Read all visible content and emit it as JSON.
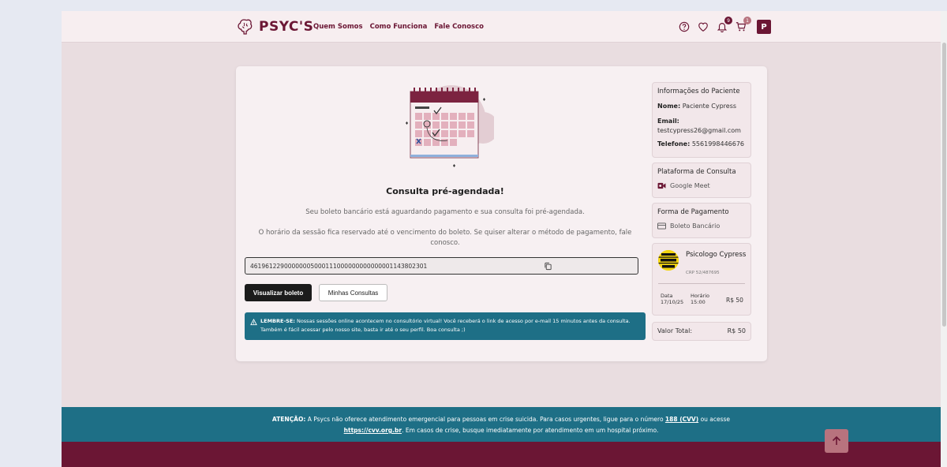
{
  "header": {
    "logo_text": "PSYC'S",
    "nav": [
      "Quem Somos",
      "Como Funciona",
      "Fale Conosco"
    ],
    "notification_count": "9",
    "cart_count": "1",
    "avatar_letter": "P",
    "colors": {
      "brand": "#6b1634",
      "header_bg": "#f7eef0"
    }
  },
  "main": {
    "title": "Consulta pré-agendada!",
    "message1": "Seu boleto bancário está aguardando pagamento e sua consulta foi pré-agendada.",
    "message2": "O horário da sessão fica reservado até o vencimento do boleto. Se quiser alterar o método de pagamento, fale conosco.",
    "boleto_code": "46196122900000005000111000000000000001143802301",
    "view_button": "Visualizar boleto",
    "consultas_button": "Minhas Consultas",
    "alert_label": "LEMBRE-SE:",
    "alert_text": "Nossas sessões online acontecem no consultório virtual! Você receberá o link de acesso por e-mail 15 minutos antes da consulta. Também é fácil acessar pelo nosso site, basta ir até o seu perfil. Boa consulta ;)"
  },
  "side": {
    "patient": {
      "heading": "Informações do Paciente",
      "name_label": "Nome:",
      "name": "Paciente Cypress",
      "email_label": "Email:",
      "email": "testcypress26@gmail.com",
      "phone_label": "Telefone:",
      "phone": "5561998446676"
    },
    "platform": {
      "heading": "Plataforma de Consulta",
      "value": "Google Meet"
    },
    "payment": {
      "heading": "Forma de Pagamento",
      "value": "Boleto Bancário"
    },
    "psychologist": {
      "name": "Psicologo Cypress",
      "crp": "CRP 52/487695",
      "date_label": "Data",
      "date": "17/10/25",
      "time_label": "Horário",
      "time": "15:00",
      "price": "R$ 50",
      "photo_text": "ATENÇÃO ÁREA DE TESTE"
    },
    "total": {
      "label": "Valor Total:",
      "value": "R$ 50"
    }
  },
  "footer": {
    "label": "ATENÇÃO:",
    "text1": "A Psycs não oferece atendimento emergencial para pessoas em crise suicida. Para casos urgentes, ligue para o número",
    "cvv": "188 (CVV)",
    "text2": "ou acesse",
    "link": "https://cvv.org.br",
    "text3": ". Em casos de crise, busque imediatamente por atendimento em um hospital próximo."
  }
}
